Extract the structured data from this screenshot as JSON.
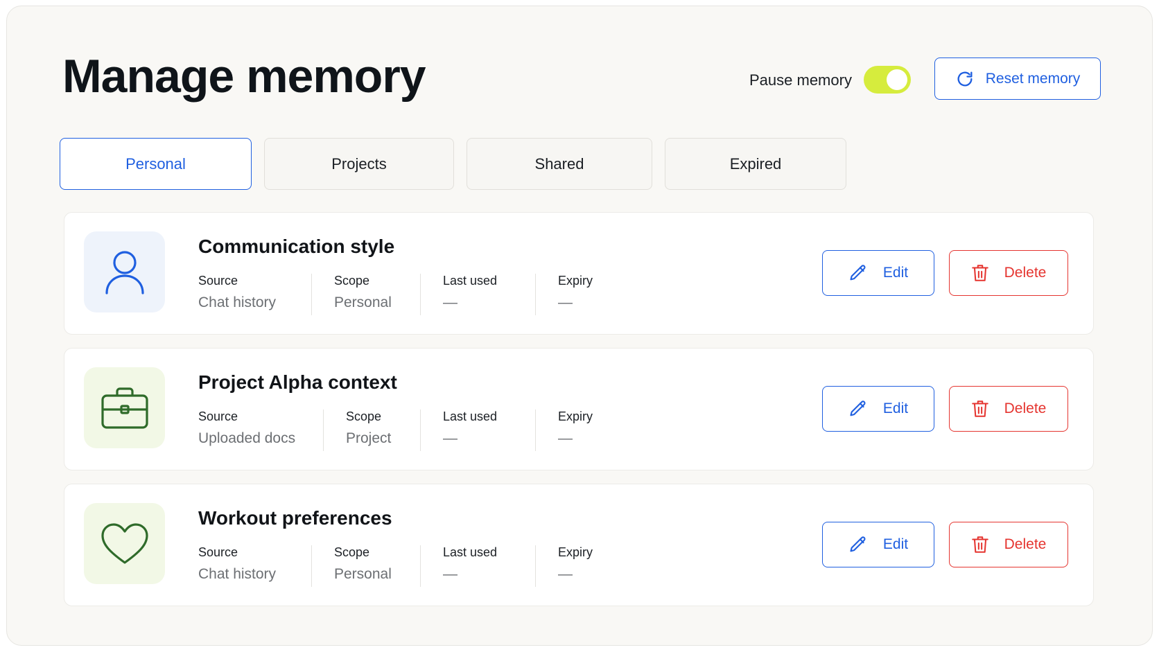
{
  "header": {
    "title": "Manage memory",
    "pause_label": "Pause memory",
    "pause_enabled": true,
    "reset_label": "Reset memory"
  },
  "tabs": [
    {
      "label": "Personal",
      "active": true
    },
    {
      "label": "Projects",
      "active": false
    },
    {
      "label": "Shared",
      "active": false
    },
    {
      "label": "Expired",
      "active": false
    }
  ],
  "meta_labels": {
    "source": "Source",
    "scope": "Scope",
    "last_used": "Last used",
    "expiry": "Expiry"
  },
  "actions": {
    "edit": "Edit",
    "delete": "Delete"
  },
  "memories": [
    {
      "title": "Communication style",
      "icon": "user-icon",
      "source": "Chat history",
      "scope": "Personal",
      "last_used": "—",
      "expiry": "—"
    },
    {
      "title": "Project Alpha context",
      "icon": "briefcase-icon",
      "source": "Uploaded docs",
      "scope": "Project",
      "last_used": "—",
      "expiry": "—"
    },
    {
      "title": "Workout preferences",
      "icon": "heart-icon",
      "source": "Chat history",
      "scope": "Personal",
      "last_used": "—",
      "expiry": "—"
    }
  ],
  "colors": {
    "accent": "#1f5fe0",
    "danger": "#e5342f",
    "toggle_on": "#d6ec3d",
    "icon_green": "#2f6b2a"
  }
}
